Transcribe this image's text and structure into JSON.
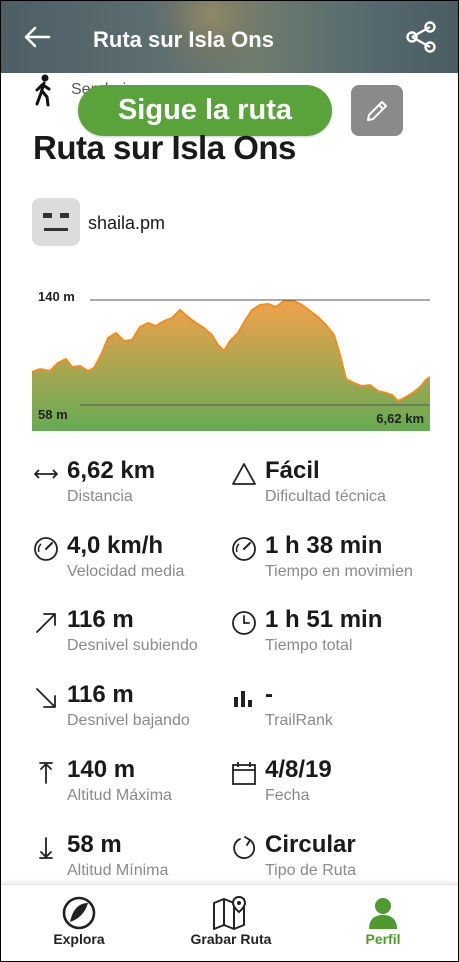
{
  "header": {
    "title": "Ruta sur Isla Ons"
  },
  "sport": {
    "label": "Senderismo"
  },
  "actions": {
    "follow_label": "Sigue la ruta"
  },
  "route": {
    "title": "Ruta sur Isla Ons"
  },
  "user": {
    "name": "shaila.pm"
  },
  "elevation": {
    "max_label": "140 m",
    "min_label": "58 m",
    "distance_label": "6,62 km",
    "colors": {
      "fill_top": "#f0a24a",
      "fill_bottom": "#66aa55",
      "line": "#f28c1e"
    }
  },
  "stats": [
    {
      "value": "6,62 km",
      "label": "Distancia",
      "icon": "distance-icon"
    },
    {
      "value": "Fácil",
      "label": "Dificultad técnica",
      "icon": "difficulty-icon"
    },
    {
      "value": "4,0 km/h",
      "label": "Velocidad media",
      "icon": "speedometer-icon"
    },
    {
      "value": "1 h 38 min",
      "label": "Tiempo en movimien",
      "icon": "moving-time-icon"
    },
    {
      "value": "116 m",
      "label": "Desnivel subiendo",
      "icon": "elevation-up-icon"
    },
    {
      "value": "1 h 51 min",
      "label": "Tiempo total",
      "icon": "clock-icon"
    },
    {
      "value": "116 m",
      "label": "Desnivel bajando",
      "icon": "elevation-down-icon"
    },
    {
      "value": "-",
      "label": "TrailRank",
      "icon": "trailrank-icon"
    },
    {
      "value": "140 m",
      "label": "Altitud Máxima",
      "icon": "max-altitude-icon"
    },
    {
      "value": "4/8/19",
      "label": "Fecha",
      "icon": "calendar-icon"
    },
    {
      "value": "58 m",
      "label": "Altitud Mínima",
      "icon": "min-altitude-icon"
    },
    {
      "value": "Circular",
      "label": "Tipo de Ruta",
      "icon": "circular-route-icon"
    }
  ],
  "nav": {
    "explore": "Explora",
    "record": "Grabar Ruta",
    "profile": "Perfil",
    "active_color": "#4f9a2e"
  }
}
